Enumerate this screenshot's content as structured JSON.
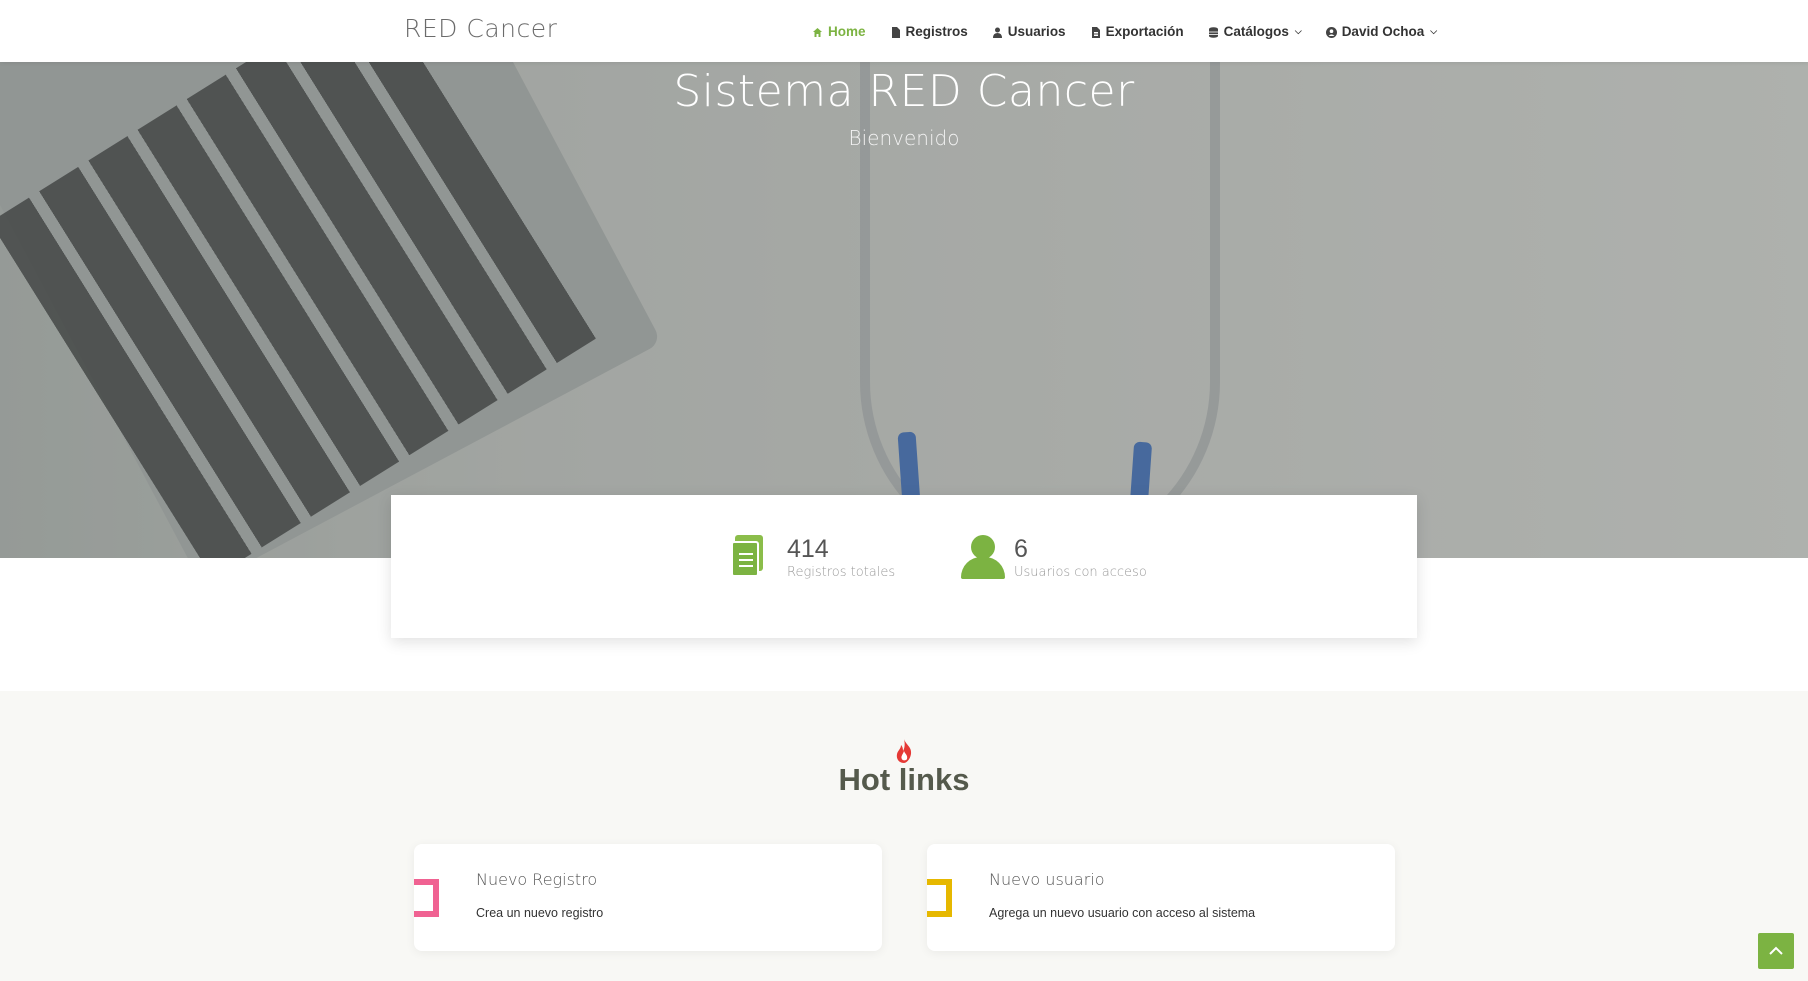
{
  "brand": "RED Cancer",
  "nav": {
    "home": "Home",
    "registros": "Registros",
    "usuarios": "Usuarios",
    "exportacion": "Exportación",
    "catalogos": "Catálogos",
    "user": "David Ochoa"
  },
  "colors": {
    "accent": "#7cb342",
    "pink": "#f06292",
    "yellow": "#e6b800",
    "flame": "#e53935"
  },
  "hero": {
    "title": "Sistema RED Cancer",
    "subtitle": "Bienvenido"
  },
  "stats": [
    {
      "value": "414",
      "label": "Registros totales",
      "icon": "document-icon"
    },
    {
      "value": "6",
      "label": "Usuarios con acceso",
      "icon": "user-icon"
    }
  ],
  "hot_links": {
    "title": "Hot links",
    "cards": [
      {
        "title": "Nuevo Registro",
        "desc": "Crea un nuevo registro"
      },
      {
        "title": "Nuevo usuario",
        "desc": "Agrega un nuevo usuario con acceso al sistema"
      }
    ]
  }
}
